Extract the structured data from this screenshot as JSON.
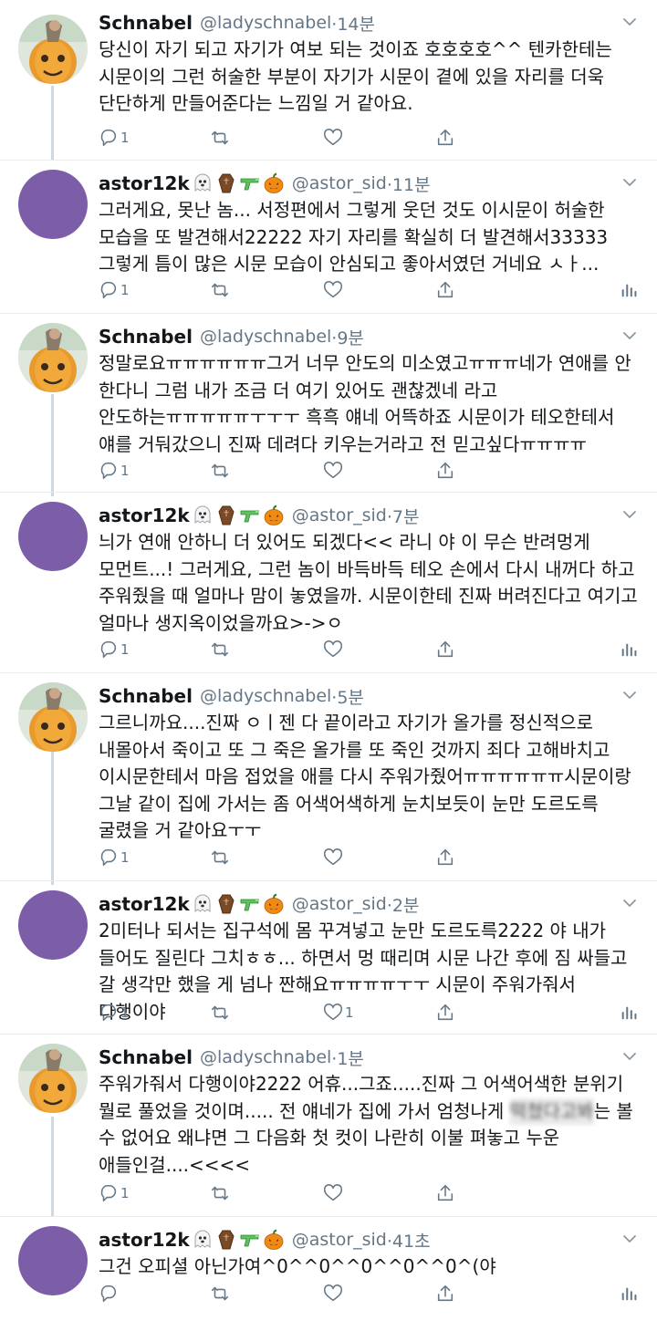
{
  "accounts": {
    "schnabel": {
      "name": "Schnabel",
      "handle": "@ladyschnabel"
    },
    "astor": {
      "name": "astor12k",
      "handle": "@astor_sid",
      "emoji_icons": [
        "ghost-icon",
        "coffin-icon",
        "water-gun-icon",
        "jack-o-lantern-icon"
      ]
    }
  },
  "tweets": [
    {
      "author": "Schnabel",
      "handle": "@ladyschnabel",
      "time": "·14분",
      "text": "당신이 자기 되고 자기가 여보 되는 것이죠 호호호호^^ 텐카한테는 시문이의 그런 허술한 부분이 자기가 시문이 곁에 있을 자리를 더욱 단단하게 만들어준다는 느낌일 거 같아요.",
      "reply_count": "1",
      "like_count": ""
    },
    {
      "author": "astor12k",
      "handle": "@astor_sid",
      "time": "·11분",
      "text": "그러게요, 못난 놈... 서정편에서 그렇게 웃던 것도 이시문이 허술한 모습을 또 발견해서22222 자기 자리를 확실히 더 발견해서33333 그렇게 틈이 많은 시문 모습이 안심되고 좋아서였던 거네요 ㅅㅏ...",
      "reply_count": "1",
      "like_count": ""
    },
    {
      "author": "Schnabel",
      "handle": "@ladyschnabel",
      "time": "·9분",
      "text": "정말로요ㅠㅠㅠㅠㅠㅠ그거 너무 안도의 미소였고ㅠㅠㅠ네가 연애를 안 한다니 그럼 내가 조금 더 여기 있어도 괜찮겠네 라고 안도하는ㅠㅠㅠㅠㅠㅜㅜㅜ 흑흑 얘네 어뜩하죠 시문이가 테오한테서 얘를 거둬갔으니 진짜 데려다 키우는거라고 전 믿고싶다ㅠㅠㅠㅠ",
      "reply_count": "1",
      "like_count": ""
    },
    {
      "author": "astor12k",
      "handle": "@astor_sid",
      "time": "·7분",
      "text": "늬가 연애 안하니 더 있어도 되겠다<< 라니 야 이 무슨 반려멍게 모먼트...! 그러게요, 그런 놈이 바득바득 테오 손에서 다시 내꺼다 하고 주워줬을 때 얼마나 맘이 놓였을까. 시문이한테 진짜 버려진다고 여기고 얼마나 생지옥이었을까요>->ㅇ",
      "reply_count": "1",
      "like_count": ""
    },
    {
      "author": "Schnabel",
      "handle": "@ladyschnabel",
      "time": "·5분",
      "text": "그르니까요....진짜 ㅇㅣ젠 다 끝이라고 자기가 올가를 정신적으로 내몰아서 죽이고 또 그 죽은 올가를 또 죽인 것까지 죄다 고해바치고 이시문한테서 마음 접었을 애를 다시 주워가줬어ㅠㅠㅠㅠㅠㅠ시문이랑 그날 같이 집에 가서는 좀 어색어색하게 눈치보듯이 눈만 도르도륵 굴렸을 거 같아요ㅜㅜ",
      "reply_count": "1",
      "like_count": ""
    },
    {
      "author": "astor12k",
      "handle": "@astor_sid",
      "time": "·2분",
      "text": "2미터나 되서는 집구석에 몸 꾸겨넣고 눈만 도르도륵2222 야 내가 들어도 질린다 그치ㅎㅎ... 하면서 멍 때리며 시문 나간 후에 짐 싸들고 갈 생각만 했을 게 넘나 짠해요ㅠㅠㅠㅠㅜㅜ 시문이 주워가줘서 다행이야",
      "reply_count": "1",
      "like_count": "1"
    },
    {
      "author": "Schnabel",
      "handle": "@ladyschnabel",
      "time": "·1분",
      "text_before": "주워가줘서 다행이야2222 어휴...그죠.....진짜 그 어색어색한 분위기 뭘로 풀었을 것이며..... 전 얘네가 집에 가서 엄청나게 ",
      "text_blurred": "떡쳤다고봐",
      "text_after": "는 볼 수 없어요 왜냐면 그 다음화 첫 컷이 나란히 이불 펴놓고 누운 애들인걸....<<<<",
      "reply_count": "1",
      "like_count": ""
    },
    {
      "author": "astor12k",
      "handle": "@astor_sid",
      "time": "·41초",
      "text": "그건 오피셜 아닌가여^0^^0^^0^^0^^0^(야",
      "reply_count": "",
      "like_count": ""
    }
  ],
  "icons": [
    "reply-icon",
    "retweet-icon",
    "like-icon",
    "share-icon",
    "analytics-icon",
    "chevron-down-icon"
  ],
  "colors": {
    "text": "#14171a",
    "secondary": "#657786",
    "avatar_purple": "#7b5ea7",
    "thread_line": "#cfd9de"
  }
}
